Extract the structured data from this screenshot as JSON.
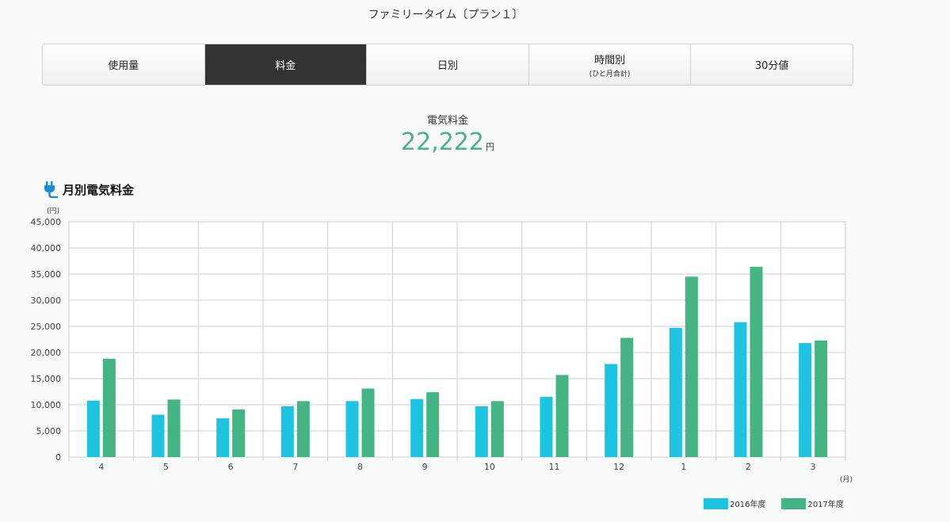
{
  "page": {
    "plan_title": "ファミリータイム〔プラン１〕",
    "tabs": [
      {
        "label": "使用量",
        "sub": "",
        "active": false
      },
      {
        "label": "料金",
        "sub": "",
        "active": true
      },
      {
        "label": "日別",
        "sub": "",
        "active": false
      },
      {
        "label": "時間別",
        "sub": "(ひと月合計)",
        "active": false
      },
      {
        "label": "30分値",
        "sub": "",
        "active": false
      }
    ],
    "summary": {
      "label": "電気料金",
      "value": "22,222",
      "unit": "円"
    },
    "section_title": "月別電気料金",
    "section_icon": "plug-icon"
  },
  "colors": {
    "series_2016": "#1cc4e2",
    "series_2017": "#44b485",
    "accent": "#4fae8f"
  },
  "chart_data": {
    "type": "bar",
    "title": "",
    "xlabel": "(月)",
    "ylabel": "(円)",
    "ylim": [
      0,
      45000
    ],
    "yticks": [
      0,
      5000,
      10000,
      15000,
      20000,
      25000,
      30000,
      35000,
      40000,
      45000
    ],
    "ytick_labels": [
      "0",
      "5,000",
      "10,000",
      "15,000",
      "20,000",
      "25,000",
      "30,000",
      "35,000",
      "40,000",
      "45,000"
    ],
    "categories": [
      "4",
      "5",
      "6",
      "7",
      "8",
      "9",
      "10",
      "11",
      "12",
      "1",
      "2",
      "3"
    ],
    "series": [
      {
        "name": "2016年度",
        "values": [
          10800,
          8100,
          7400,
          9700,
          10700,
          11100,
          9700,
          11500,
          17800,
          24700,
          25800,
          21800
        ]
      },
      {
        "name": "2017年度",
        "values": [
          18800,
          11000,
          9100,
          10700,
          13100,
          12400,
          10700,
          15700,
          22800,
          34500,
          36400,
          22300
        ]
      }
    ],
    "grid": true,
    "legend": "bottom-right"
  }
}
